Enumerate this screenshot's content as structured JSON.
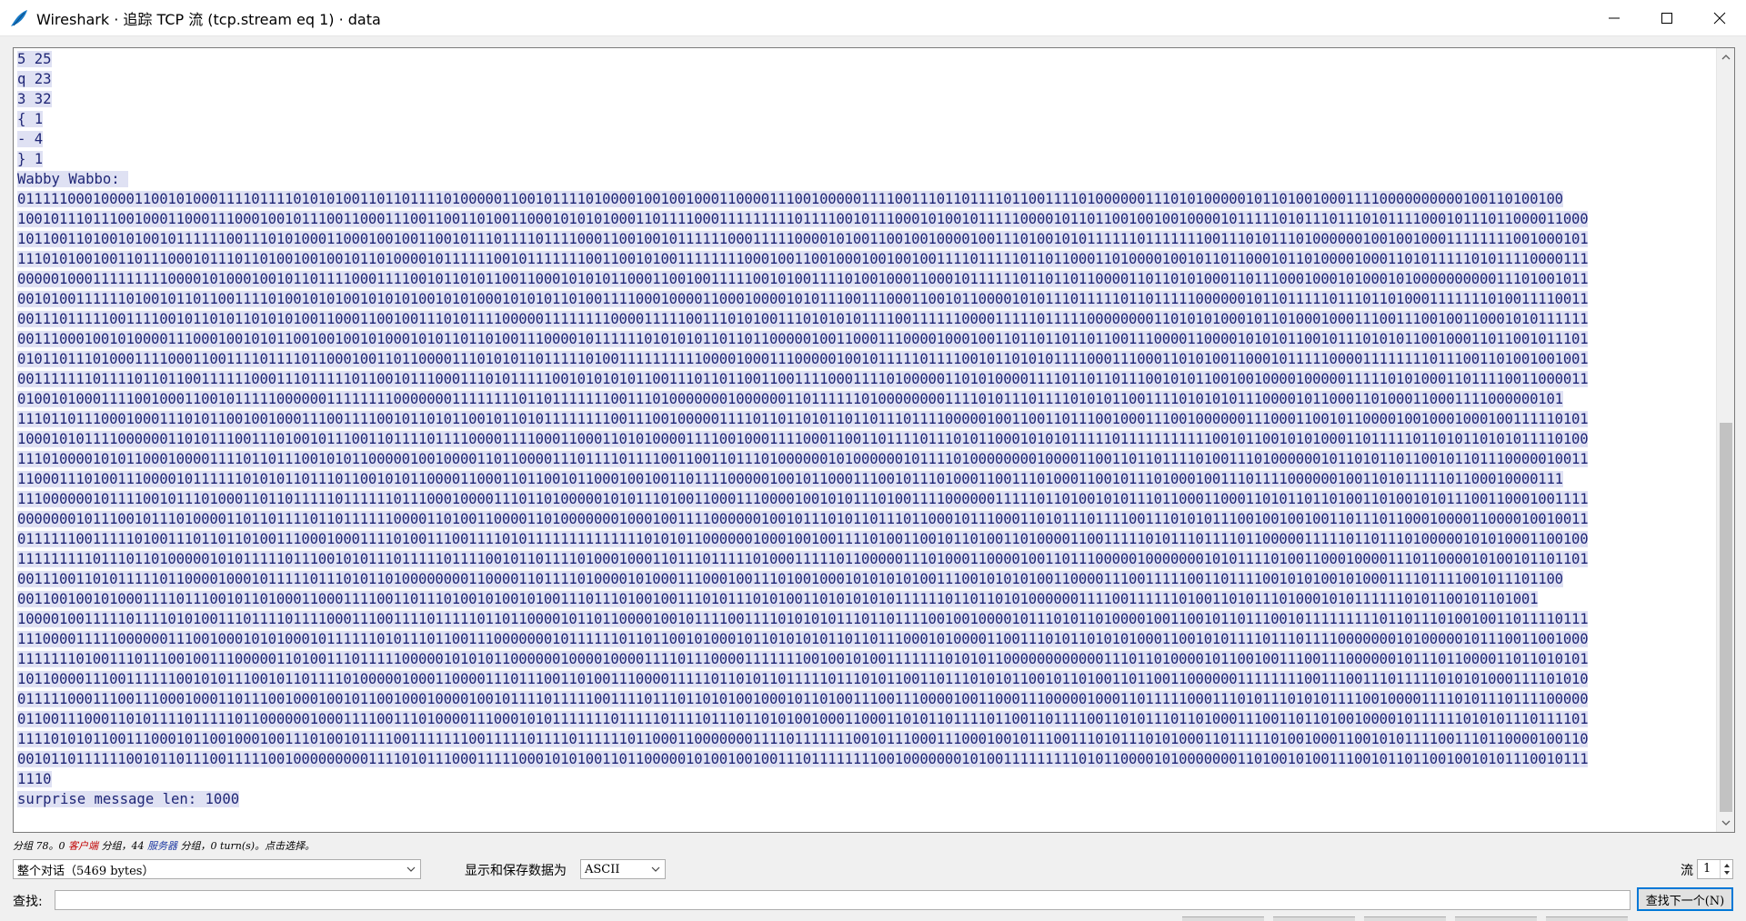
{
  "window": {
    "title": "Wireshark · 追踪 TCP 流 (tcp.stream eq 1) · data"
  },
  "stream": {
    "lines": [
      "5 25",
      "q 23",
      "3 32",
      "{ 1",
      "- 4",
      "} 1",
      "Wabby Wabbo: ",
      "01111100010000110010100011110111101010100110110111101000001100101111010000100100100011000011100100000111100111011011110110011110100000011101010000010110100100011110000000000100110100100",
      "10010111011100100011000111000100101110011000111001100110100110001010101000110111100011111111101111001011100010100101111100001011011001001001000010111110101110111010111100010111011000011000",
      "10110011010010100101111110011101010001100010010011001011101111011110001100100101111110001111100001010011001001000010011101001010111111011111110011101011101000000100100100011111111001000101",
      "11101010010011011100010111011010010010010110100001011111100101111111001100101001111111100010011001000100100100111101111101101100011010000100101101100010110100001000110101111101011110000111",
      "00000100011111111100001010001001011011110001111001011010110011000101010110001100100111110010100111101001000110001011111101101101100001101101010001101110001000101000101000000000011101001011",
      "00101001111110100101101100111101001010100101010100101010001010101101001111000100001100010000101011100111000110010110000101011101111101101111100000010110111110111011010001111111010011110011",
      "00111011111001111001011010110101010011000110010011101011110000011111111000011111001110101001110101010111100111111000011111011111000000001101010100010110100010001110011100100110001010111111",
      "00111000100101000011100010010101100100100101000101011011010011100001011111101010101101101100000100110001110000100010011011011011011001110000110000101010110010111010101100100011011001011101",
      "01011011101000111100011001111011110110001001101100001110101011011111010011111111110000100011100000100101111101111001011010101111000111000110101001100010111110000111111110111001101001001001",
      "00111111101111011011001111110001110111110110010111000111010111110010101010110011101101100110011110001111010000011010100001111011011011100101011001001000010000011111010100011011110011000011",
      "01001010001111001000110010111110000001111111100000001111111101101111111001110100000001000000110111111010000000011110101110111101010110011110101010111000010110001101000110001111000000101",
      "11101101110001000111010110010010001110011110010110101100101101011111111001110010000011110110110101101101110111100000100110011011100100011100100000011100011001011000010010001000100111110101",
      "10001010111100000011010111001110100101110011011110111100001111000110001101010000111100100011110001100110111101110101100010101011111011111111111001011001010100011011111011010110101011110100",
      "11101000010101100010000111101101110010101100000100100001101100001110111101111001100110111010000001010000001011110100000000100001100110110111101001110100000010110101101100101101110000010011",
      "11000111010011100001011111101010110111011001010110000110001101100101100010010011011110000010010110001110010111010001100111010001100101110100010011101111000000100110101111101100010000111",
      "11100000010111100101110100011011011111011111101110001000011101101000001010111010011000111000010010101110100111100000011111011010010101110110001100011010110110100110100101011100110001001111",
      "00000001011100101110100001101101111011011111100001101001100001101000000010001001111000000100101110101101110110001011100011010111011110011101010111001001001001101110110001000011000010010011",
      "01111110011111010011101101101001110001000111101001110011110101111111111111101010110000001000100100111101001100101101001101000011001111101011101111011000001111101101110100000101010001100100",
      "11111111101110110100000101011111011100101011101111101111001011011110100010001101110111110100011111011000001110100011000010011011100000100000001010111101001100010000111011000010100101101101",
      "00111001101011111011000010001011111011101011010000000011000011011110100001010001110001001110100100010101010100111001010101001100001110011111001101111001010100101000111101111001011101100",
      "00110010010100011110111001011010001100011110011011101001010010100111011101001001110101110101001101010101011111101101101010000001111001111110100110101110100010101111110101100101101001",
      "10000100111110111101010011101111011110001110011110111110110110000101101100001001011110011110101010111011011110010010000101110101101000010011001011011100101111111110110111010010011011110111",
      "11100001111100000011100100010101000101111110101110110011100000001011111101101100101000101101010101101101110001010000110011101011010101000110010101111011101111000000010100000101110011001000",
      "11111110100111011100100111000001101001110111110000010101011000000100001000011110111000011111110010010100111111101010110000000000001110110100001011001001110011100000010111011000011011010101",
      "10110000111001111110010101110010110111101000001000110000111011100110100111000011111011010110111110111010110011011101010110010110100110110011000000111111110011100111011111010101000111101010",
      "01111100011100111000100011011100100010010110010001000010010111101111100111101110110101001000101101001110011100001001100011100000100011011111000111010111010101111001000011110101110111100000",
      "01100111000110101111011111011000000100011110011101000011100010101111111011111011110111011010100100011000110101101111011001101111001101011101101000111001101101001000010111111010101110111101",
      "11110101011001110001011001000100111010010111100111111100111110111101111110110001100000001111011111110010111000111000100101110011101011101010001101111101001000110010101111001110110000100110",
      "00101101111110010110111001111100100000000011110101110001111100010101001101100000101001001001110111111110010000000101001111111110101100001010000000110100101001110010110110010010101110010111",
      "1110",
      "surprise message len: 1000"
    ]
  },
  "status_line": {
    "prefix": "分组 78。0 ",
    "client": "客户端",
    "mid1": " 分组，44 ",
    "server": "服务器",
    "mid2": " 分组，0 turn(s)。点击选择。"
  },
  "controls": {
    "conversation_select": "整个对话（5469 bytes）",
    "show_as_label": "显示和保存数据为",
    "show_as_select": "ASCII",
    "stream_label": "流",
    "stream_value": "1",
    "find_label": "查找:",
    "find_next_button": "查找下一个(N)"
  },
  "colors": {
    "client_highlight_bg": "#dfe1f3",
    "client_text": "#1f2676",
    "accent": "#0078d7"
  }
}
